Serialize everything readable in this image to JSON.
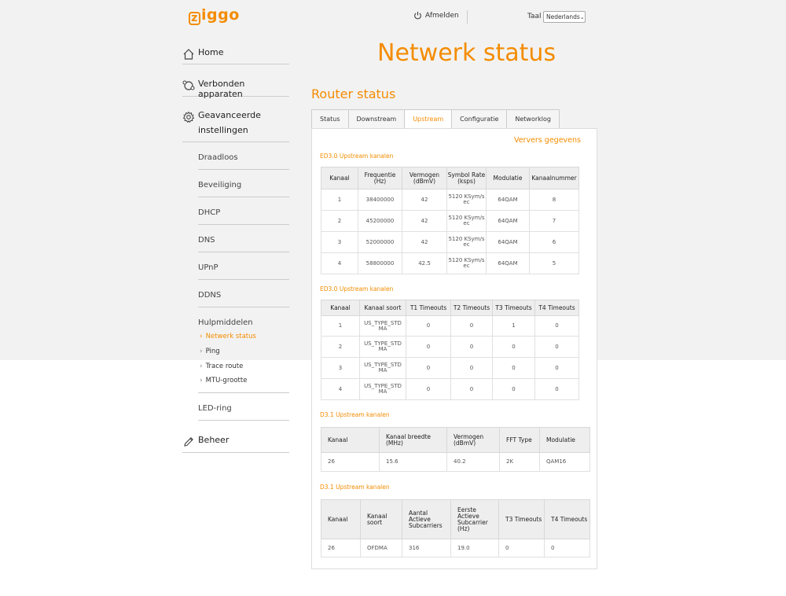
{
  "brand": {
    "logo_box": "z",
    "logo_rest": "iggo",
    "accent": "#f48c00"
  },
  "header": {
    "logout_label": "Afmelden",
    "lang_label": "Taal",
    "lang_value": "Nederlands"
  },
  "page_title": "Netwerk status",
  "sidebar": {
    "home": "Home",
    "devices": "Verbonden apparaten",
    "advanced_line1": "Geavanceerde",
    "advanced_line2": "instellingen",
    "advanced_items": [
      "Draadloos",
      "Beveiliging",
      "DHCP",
      "DNS",
      "UPnP",
      "DDNS"
    ],
    "tools_label": "Hulpmiddelen",
    "tools_items": [
      "Netwerk status",
      "Ping",
      "Trace route",
      "MTU-grootte"
    ],
    "led": "LED-ring",
    "beheer": "Beheer"
  },
  "section_title": "Router status",
  "tabs": [
    "Status",
    "Downstream",
    "Upstream",
    "Configuratie",
    "Networklog"
  ],
  "active_tab": "Upstream",
  "refresh_label": "Ververs gegevens",
  "tables": {
    "t1": {
      "title": "ED3.0 Upstream kanalen",
      "headers": [
        "Kanaal",
        "Frequentie (Hz)",
        "Vermogen (dBmV)",
        "Symbol Rate (ksps)",
        "Modulatie",
        "Kanaalnummer"
      ],
      "rows": [
        [
          "1",
          "38400000",
          "42",
          "5120 KSym/s ec",
          "64QAM",
          "8"
        ],
        [
          "2",
          "45200000",
          "42",
          "5120 KSym/s ec",
          "64QAM",
          "7"
        ],
        [
          "3",
          "52000000",
          "42",
          "5120 KSym/s ec",
          "64QAM",
          "6"
        ],
        [
          "4",
          "58800000",
          "42.5",
          "5120 KSym/s ec",
          "64QAM",
          "5"
        ]
      ]
    },
    "t2": {
      "title": "ED3.0 Upstream kanalen",
      "headers": [
        "Kanaal",
        "Kanaal soort",
        "T1 Timeouts",
        "T2 Timeouts",
        "T3 Timeouts",
        "T4 Timeouts"
      ],
      "rows": [
        [
          "1",
          "US_TYPE_STD MA",
          "0",
          "0",
          "1",
          "0"
        ],
        [
          "2",
          "US_TYPE_STD MA",
          "0",
          "0",
          "0",
          "0"
        ],
        [
          "3",
          "US_TYPE_STD MA",
          "0",
          "0",
          "0",
          "0"
        ],
        [
          "4",
          "US_TYPE_STD MA",
          "0",
          "0",
          "0",
          "0"
        ]
      ]
    },
    "t3": {
      "title": "D3.1 Upstream kanalen",
      "headers": [
        "Kanaal",
        "Kanaal breedte (MHz)",
        "Vermogen (dBmV)",
        "FFT Type",
        "Modulatie"
      ],
      "rows": [
        [
          "26",
          "15.6",
          "40.2",
          "2K",
          "QAM16"
        ]
      ]
    },
    "t4": {
      "title": "D3.1 Upstream kanalen",
      "headers": [
        "Kanaal",
        "Kanaal soort",
        "Aantal Actieve Subcarriers",
        "Eerste Actieve Subcarrier (Hz)",
        "T3 Timeouts",
        "T4 Timeouts"
      ],
      "rows": [
        [
          "26",
          "OFDMA",
          "316",
          "19.0",
          "0",
          "0"
        ]
      ]
    }
  }
}
